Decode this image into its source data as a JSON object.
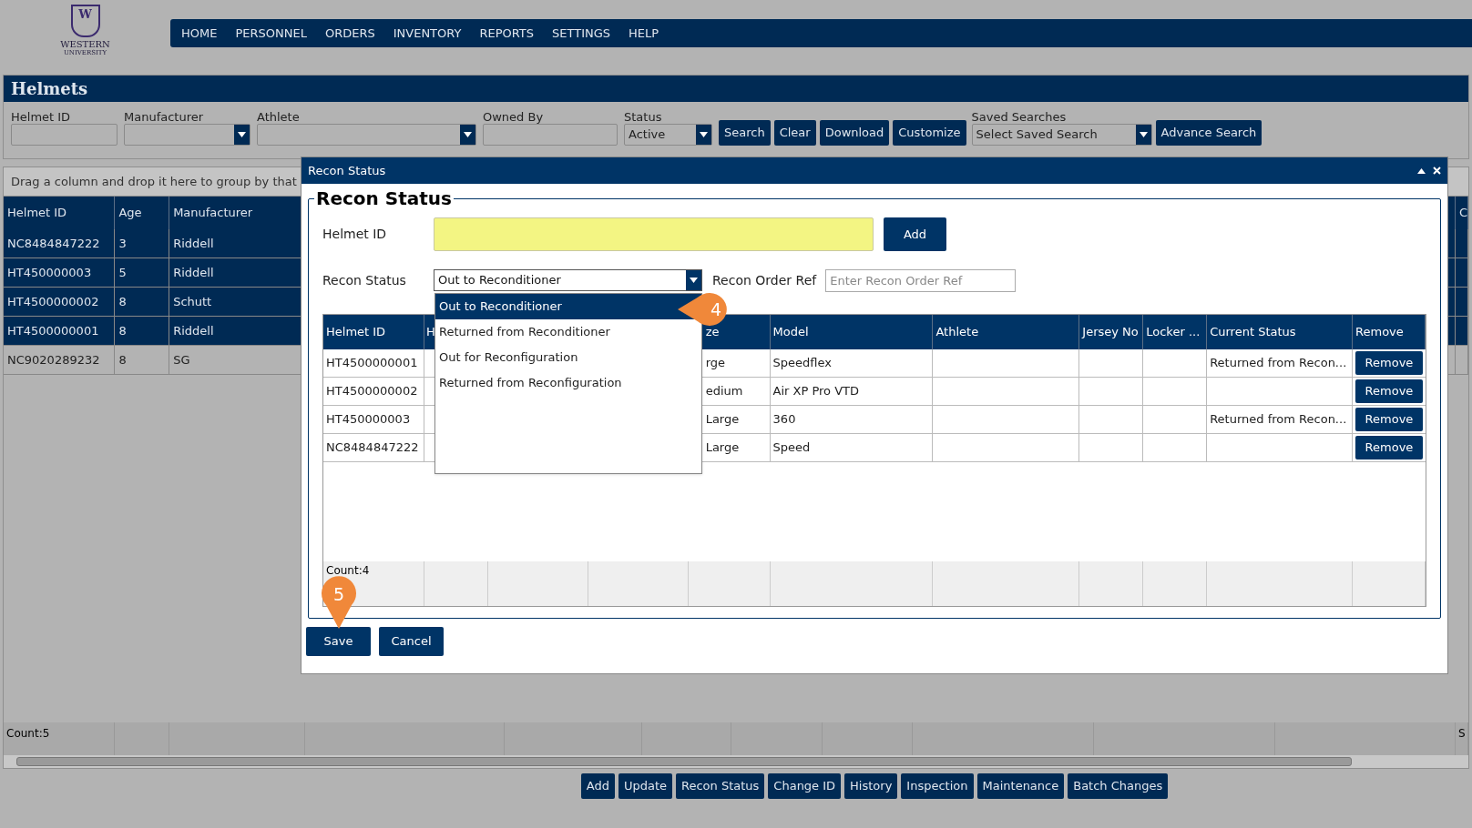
{
  "logo": {
    "initial": "W",
    "name": "WESTERN",
    "sub": "UNIVERSITY"
  },
  "nav": [
    "HOME",
    "PERSONNEL",
    "ORDERS",
    "INVENTORY",
    "REPORTS",
    "SETTINGS",
    "HELP"
  ],
  "panel": {
    "title": "Helmets",
    "filters": [
      {
        "kind": "input",
        "label": "Helmet ID"
      },
      {
        "kind": "select",
        "label": "Manufacturer"
      },
      {
        "kind": "select",
        "label": "Athlete"
      },
      {
        "kind": "input",
        "label": "Owned By"
      },
      {
        "kind": "select",
        "label": "Status",
        "value": "Active"
      }
    ],
    "buttons": [
      "Search",
      "Clear",
      "Download",
      "Customize"
    ],
    "saved": {
      "label": "Saved Searches",
      "value": "Select Saved Search"
    },
    "advance": "Advance Search"
  },
  "grid": {
    "group_hint": "Drag a column and drop it here to group by that",
    "columns": [
      "Helmet ID",
      "Age",
      "Manufacturer",
      "C"
    ],
    "rows": [
      {
        "id": "NC8484847222",
        "age": "3",
        "mfr": "Riddell",
        "selected": true
      },
      {
        "id": "HT450000003",
        "age": "5",
        "mfr": "Riddell",
        "selected": true
      },
      {
        "id": "HT4500000002",
        "age": "8",
        "mfr": "Schutt",
        "selected": true
      },
      {
        "id": "HT4500000001",
        "age": "8",
        "mfr": "Riddell",
        "selected": true
      },
      {
        "id": "NC9020289232",
        "age": "8",
        "mfr": "SG",
        "selected": false
      }
    ],
    "footer": {
      "count": "Count:5",
      "last": "S"
    }
  },
  "actions": [
    "Add",
    "Update",
    "Recon Status",
    "Change ID",
    "History",
    "Inspection",
    "Maintenance",
    "Batch Changes"
  ],
  "modal": {
    "title": "Recon Status",
    "legend": "Recon Status",
    "helmet_label": "Helmet ID",
    "add": "Add",
    "status_label": "Recon Status",
    "status_value": "Out to Reconditioner",
    "order_label": "Recon Order Ref",
    "order_placeholder": "Enter Recon Order Ref",
    "options": [
      {
        "label": "Out to Reconditioner",
        "selected": true
      },
      {
        "label": "Returned from Reconditioner",
        "selected": false
      },
      {
        "label": "Out for Reconfiguration",
        "selected": false
      },
      {
        "label": "Returned from Reconfiguration",
        "selected": false
      }
    ],
    "columns": [
      "Helmet ID",
      "H",
      "ze",
      "Model",
      "Athlete",
      "Jersey No",
      "Locker ...",
      "Current Status",
      "Remove"
    ],
    "rows": [
      {
        "id": "HT4500000001",
        "size": "rge",
        "model": "Speedflex",
        "status": "Returned from Recon...",
        "remove": "Remove"
      },
      {
        "id": "HT4500000002",
        "size": "edium",
        "model": "Air XP Pro VTD",
        "remove": "Remove"
      },
      {
        "id": "HT450000003",
        "size": "Large",
        "model": "360",
        "status": "Returned from Recon...",
        "remove": "Remove"
      },
      {
        "id": "NC8484847222",
        "size": "Large",
        "model": "Speed",
        "remove": "Remove"
      }
    ],
    "count": "Count:4",
    "save": "Save",
    "cancel": "Cancel"
  },
  "callouts": [
    "4",
    "5"
  ]
}
